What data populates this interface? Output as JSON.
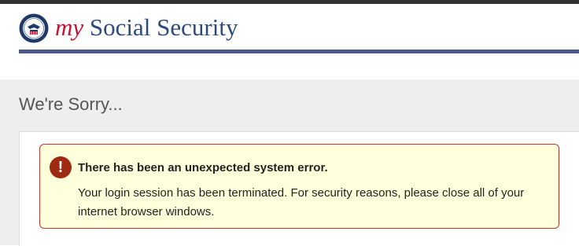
{
  "header": {
    "brand_my": "my",
    "brand_rest": " Social Security",
    "logo_icon": "ssa-seal-icon"
  },
  "page": {
    "title": "We're Sorry..."
  },
  "alert": {
    "icon": "exclamation-icon",
    "icon_glyph": "!",
    "title": "There has been an unexpected system error.",
    "message": "Your login session has been terminated. For security reasons, please close all of your internet browser windows."
  },
  "colors": {
    "brand_blue": "#2d4a7a",
    "brand_red": "#c8102e",
    "alert_background": "#ffffdb",
    "alert_border": "#c0392b",
    "alert_icon": "#9e2a12"
  }
}
